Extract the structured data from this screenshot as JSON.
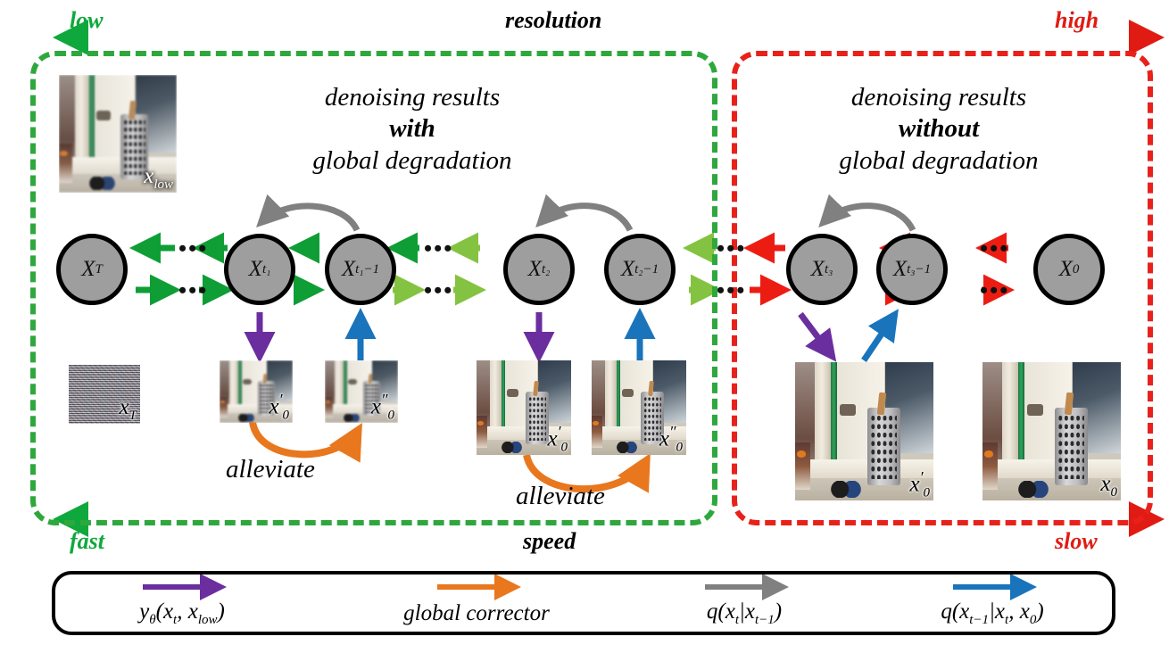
{
  "axes": {
    "resolution": {
      "left_label": "low",
      "mid_label": "resolution",
      "right_label": "high",
      "left_color": "#0FA83C",
      "right_color": "#E01B13"
    },
    "speed": {
      "left_label": "fast",
      "mid_label": "speed",
      "right_label": "slow",
      "left_color": "#0FA83C",
      "right_color": "#E01B13"
    }
  },
  "regions": {
    "left": {
      "title_line1": "denoising results",
      "title_emphasis": "with",
      "title_line3": "global degradation",
      "border_color": "#2EA83C"
    },
    "right": {
      "title_line1": "denoising results",
      "title_emphasis": "without",
      "title_line3": "global degradation",
      "border_color": "#E8211A"
    }
  },
  "nodes": [
    {
      "id": "xT",
      "label": "X",
      "sub": "T"
    },
    {
      "id": "xt1",
      "label": "X",
      "sub": "t₁"
    },
    {
      "id": "xt1m1",
      "label": "X",
      "sub": "t₁−1"
    },
    {
      "id": "xt2",
      "label": "X",
      "sub": "t₂"
    },
    {
      "id": "xt2m1",
      "label": "X",
      "sub": "t₂−1"
    },
    {
      "id": "xt3",
      "label": "X",
      "sub": "t₃"
    },
    {
      "id": "xt3m1",
      "label": "X",
      "sub": "t₃−1"
    },
    {
      "id": "x0",
      "label": "X",
      "sub": "0"
    }
  ],
  "ellipsis": "•••",
  "thumbnails": [
    {
      "id": "x_low",
      "label": "x",
      "sub": "low",
      "prime": ""
    },
    {
      "id": "x_T",
      "label": "x",
      "sub": "T",
      "prime": ""
    },
    {
      "id": "x0p_a",
      "label": "x",
      "sub": "0",
      "prime": "′"
    },
    {
      "id": "x0pp_a",
      "label": "x",
      "sub": "0",
      "prime": "″"
    },
    {
      "id": "x0p_b",
      "label": "x",
      "sub": "0",
      "prime": "′"
    },
    {
      "id": "x0pp_b",
      "label": "x",
      "sub": "0",
      "prime": "″"
    },
    {
      "id": "x0p_c",
      "label": "x",
      "sub": "0",
      "prime": "′"
    },
    {
      "id": "x0_d",
      "label": "x",
      "sub": "0",
      "prime": ""
    }
  ],
  "annotations": {
    "alleviate_1": "alleviate",
    "alleviate_2": "alleviate"
  },
  "legend": {
    "items": [
      {
        "arrow_color": "#6B2E9E",
        "text": "yθ(xₜ, x_low)",
        "html": "y<sub>θ</sub>(x<sub>t</sub>, x<sub>low</sub>)",
        "name": "model-predictor"
      },
      {
        "arrow_color": "#E8771E",
        "text": "global corrector",
        "html": "global corrector",
        "name": "global-corrector"
      },
      {
        "arrow_color": "#808080",
        "text": "q(xₜ|xₜ₋₁)",
        "html": "q(x<sub>t</sub>|x<sub>t−1</sub>)",
        "name": "forward-process"
      },
      {
        "arrow_color": "#1974BC",
        "text": "q(xₜ₋₁|xₜ, x₀)",
        "html": "q(x<sub>t−1</sub>|x<sub>t</sub>, x<sub>0</sub>)",
        "name": "posterior-process"
      }
    ]
  },
  "colors": {
    "node_fill": "#9E9E9E",
    "node_stroke": "#000000",
    "arrow_dark_green": "#0E9E35",
    "arrow_light_green": "#84C341",
    "arrow_red": "#ED1C13",
    "arrow_gray": "#808080",
    "arrow_purple": "#6B2E9E",
    "arrow_blue": "#1974BC",
    "arrow_orange": "#E8771E"
  }
}
